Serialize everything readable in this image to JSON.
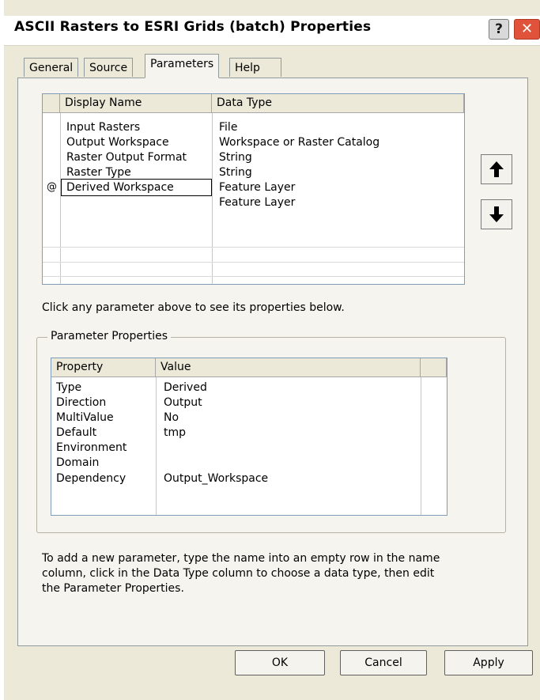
{
  "window": {
    "title": "ASCII Rasters to ESRI Grids (batch) Properties",
    "help_icon": "question-icon",
    "close_icon": "close-x-icon",
    "help_glyph": "?",
    "close_glyph": "✕"
  },
  "tabs": [
    {
      "label": "General",
      "active": false
    },
    {
      "label": "Source",
      "active": false
    },
    {
      "label": "Parameters",
      "active": true
    },
    {
      "label": "Help",
      "active": false
    }
  ],
  "params_table": {
    "headers": [
      "Display Name",
      "Data Type"
    ],
    "rows": [
      {
        "marker": "",
        "name": "Input Rasters",
        "type": "File"
      },
      {
        "marker": "",
        "name": "Output Workspace",
        "type": "Workspace or Raster Catalog"
      },
      {
        "marker": "",
        "name": "Raster Output Format",
        "type": "String"
      },
      {
        "marker": "",
        "name": "Raster Type",
        "type": "String"
      },
      {
        "marker": "@",
        "name": "Derived Workspace",
        "type": "Feature Layer"
      },
      {
        "marker": "",
        "name": "",
        "type": "Feature Layer"
      }
    ]
  },
  "move_up_icon": "arrow-up-icon",
  "move_down_icon": "arrow-down-icon",
  "hint_text": "Click any parameter above to see its properties below.",
  "group_label": "Parameter Properties",
  "props_table": {
    "headers": [
      "Property",
      "Value"
    ],
    "rows": [
      {
        "property": "Type",
        "value": "Derived"
      },
      {
        "property": "Direction",
        "value": "Output"
      },
      {
        "property": "MultiValue",
        "value": "No"
      },
      {
        "property": "Default",
        "value": "tmp"
      },
      {
        "property": "Environment",
        "value": ""
      },
      {
        "property": "Domain",
        "value": ""
      },
      {
        "property": "Dependency",
        "value": "Output_Workspace"
      }
    ]
  },
  "instructions": [
    "To add a new parameter, type the name into an empty row in the name",
    "column, click in the Data Type column to choose a data type, then edit",
    "the Parameter Properties."
  ],
  "buttons": {
    "ok": "OK",
    "cancel": "Cancel",
    "apply": "Apply"
  },
  "colors": {
    "close_button": "#e0523a",
    "dialog_face": "#ece9d8",
    "panel": "#f5f4ee"
  }
}
